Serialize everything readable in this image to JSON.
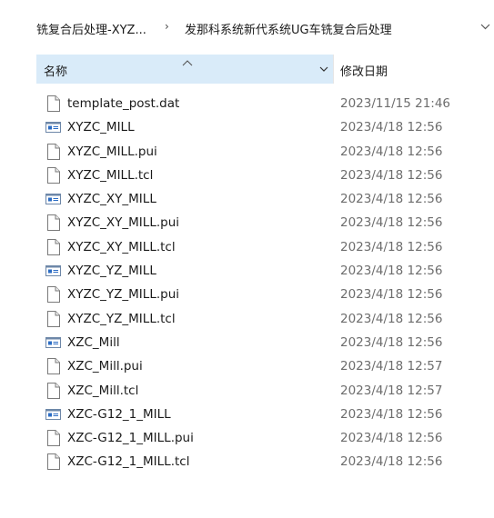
{
  "breadcrumb": {
    "parent": "铣复合后处理-XYZ...",
    "separator": "›",
    "current": "发那科系统新代系统UG车铣复合后处理"
  },
  "columns": {
    "name": "名称",
    "date_modified": "修改日期"
  },
  "files": [
    {
      "name": "template_post.dat",
      "date": "2023/11/15 21:46",
      "icon": "document-icon"
    },
    {
      "name": "XYZC_MILL",
      "date": "2023/4/18 12:56",
      "icon": "app-window-icon"
    },
    {
      "name": "XYZC_MILL.pui",
      "date": "2023/4/18 12:56",
      "icon": "document-icon"
    },
    {
      "name": "XYZC_MILL.tcl",
      "date": "2023/4/18 12:56",
      "icon": "document-icon"
    },
    {
      "name": "XYZC_XY_MILL",
      "date": "2023/4/18 12:56",
      "icon": "app-window-icon"
    },
    {
      "name": "XYZC_XY_MILL.pui",
      "date": "2023/4/18 12:56",
      "icon": "document-icon"
    },
    {
      "name": "XYZC_XY_MILL.tcl",
      "date": "2023/4/18 12:56",
      "icon": "document-icon"
    },
    {
      "name": "XYZC_YZ_MILL",
      "date": "2023/4/18 12:56",
      "icon": "app-window-icon"
    },
    {
      "name": "XYZC_YZ_MILL.pui",
      "date": "2023/4/18 12:56",
      "icon": "document-icon"
    },
    {
      "name": "XYZC_YZ_MILL.tcl",
      "date": "2023/4/18 12:56",
      "icon": "document-icon"
    },
    {
      "name": "XZC_Mill",
      "date": "2023/4/18 12:56",
      "icon": "app-window-icon"
    },
    {
      "name": "XZC_Mill.pui",
      "date": "2023/4/18 12:57",
      "icon": "document-icon"
    },
    {
      "name": "XZC_Mill.tcl",
      "date": "2023/4/18 12:57",
      "icon": "document-icon"
    },
    {
      "name": "XZC-G12_1_MILL",
      "date": "2023/4/18 12:56",
      "icon": "app-window-icon"
    },
    {
      "name": "XZC-G12_1_MILL.pui",
      "date": "2023/4/18 12:56",
      "icon": "document-icon"
    },
    {
      "name": "XZC-G12_1_MILL.tcl",
      "date": "2023/4/18 12:56",
      "icon": "document-icon"
    }
  ],
  "colors": {
    "header_highlight": "#d9ebf9",
    "date_text": "#6d6d6d",
    "app_icon_blue": "#2b6cc4"
  }
}
